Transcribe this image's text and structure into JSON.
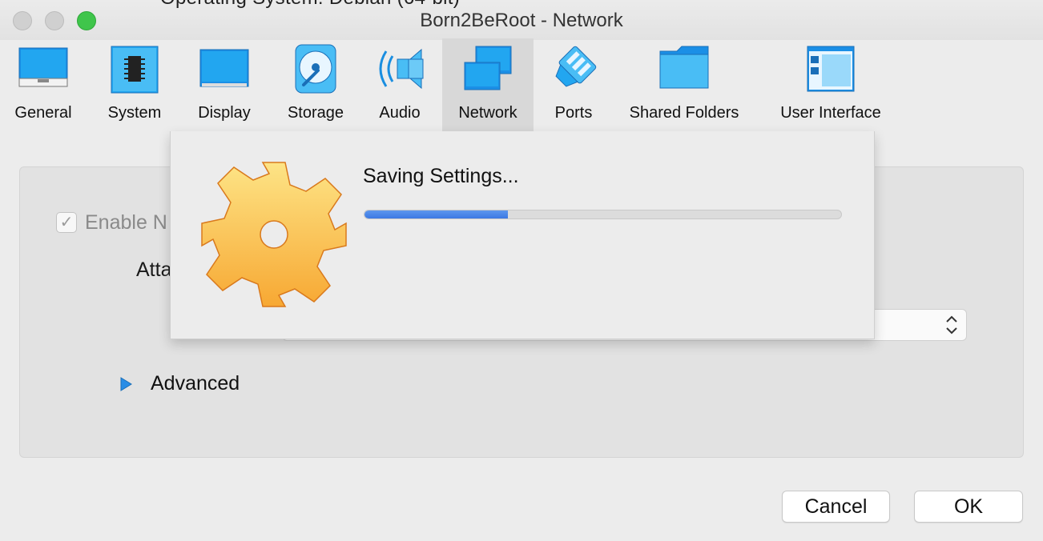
{
  "window": {
    "title": "Born2BeRoot - Network",
    "behind_text": "Operating System:   Debian (64-bit)"
  },
  "toolbar": {
    "items": [
      {
        "label": "General",
        "icon": "general-icon"
      },
      {
        "label": "System",
        "icon": "system-icon"
      },
      {
        "label": "Display",
        "icon": "display-icon"
      },
      {
        "label": "Storage",
        "icon": "storage-icon"
      },
      {
        "label": "Audio",
        "icon": "audio-icon"
      },
      {
        "label": "Network",
        "icon": "network-icon",
        "active": true
      },
      {
        "label": "Ports",
        "icon": "ports-icon"
      },
      {
        "label": "Shared Folders",
        "icon": "shared-folders-icon"
      },
      {
        "label": "User Interface",
        "icon": "user-interface-icon"
      }
    ]
  },
  "network": {
    "enable_label": "Enable N",
    "enable_checked": true,
    "attached_label": "Atta",
    "advanced_label": "Advanced"
  },
  "progress": {
    "title": "Saving Settings...",
    "percent": 30,
    "icon": "gear-icon"
  },
  "buttons": {
    "cancel": "Cancel",
    "ok": "OK"
  },
  "colors": {
    "accent_blue": "#3b78e3",
    "icon_blue": "#1aa0ec",
    "gear_orange": "#f7a833",
    "maximize_green": "#3fc54b"
  }
}
